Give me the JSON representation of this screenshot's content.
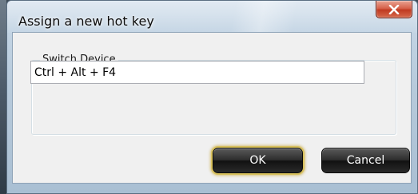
{
  "window": {
    "title": "Assign a new hot key",
    "close_glyph": "close-icon"
  },
  "group": {
    "label": "Switch Device"
  },
  "hotkey": {
    "value": "Ctrl + Alt + F4"
  },
  "buttons": {
    "ok_label": "OK",
    "cancel_label": "Cancel"
  },
  "colors": {
    "close_button": "#c03a20",
    "button_face": "#1e1e1e",
    "default_button_glow": "#d8c15d",
    "client_background": "#f0f0f0"
  }
}
